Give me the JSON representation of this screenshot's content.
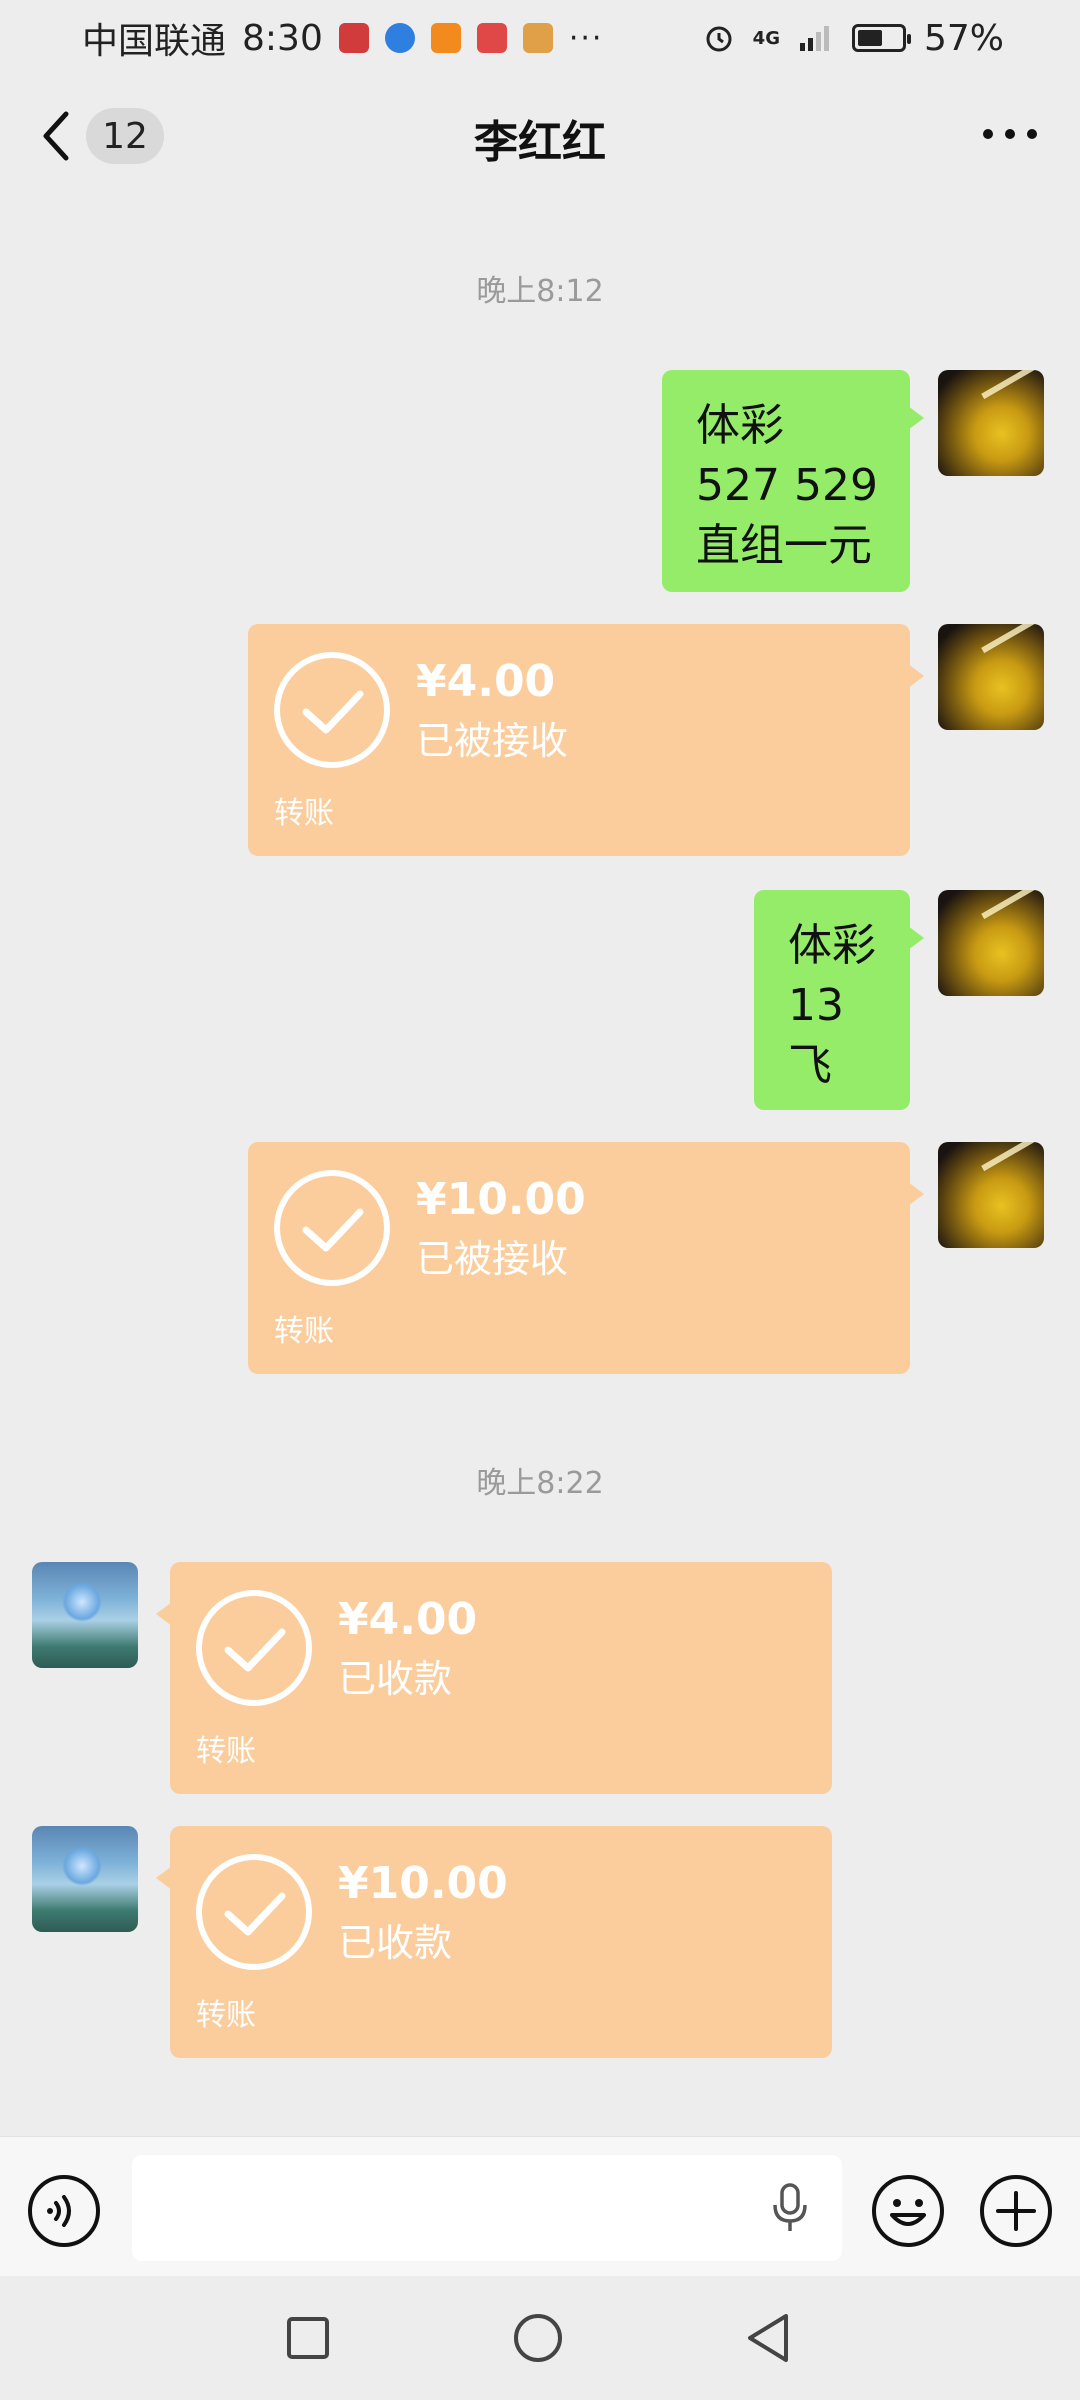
{
  "status_bar": {
    "carrier": "中国联通",
    "time": "8:30",
    "network": "4G",
    "battery": "57%",
    "battery_level": 0.57,
    "overflow": "···"
  },
  "header": {
    "unread_count": "12",
    "title": "李红红"
  },
  "messages": {
    "time_1": "晚上8:12",
    "msg1_lines": [
      "体彩",
      "527 529",
      "直组一元"
    ],
    "transfer1": {
      "amount": "¥4.00",
      "status": "已被接收",
      "label": "转账"
    },
    "msg2_lines": [
      "体彩",
      "13",
      "飞"
    ],
    "transfer2": {
      "amount": "¥10.00",
      "status": "已被接收",
      "label": "转账"
    },
    "time_2": "晚上8:22",
    "transfer3": {
      "amount": "¥4.00",
      "status": "已收款",
      "label": "转账"
    },
    "transfer4": {
      "amount": "¥10.00",
      "status": "已收款",
      "label": "转账"
    }
  },
  "input_bar": {
    "icons": [
      "voice-icon",
      "mic-icon",
      "emoji-icon",
      "plus-icon"
    ]
  },
  "colors": {
    "background": "#ededed",
    "text_bubble": "#95ec69",
    "transfer_card": "#fbcd9c"
  }
}
